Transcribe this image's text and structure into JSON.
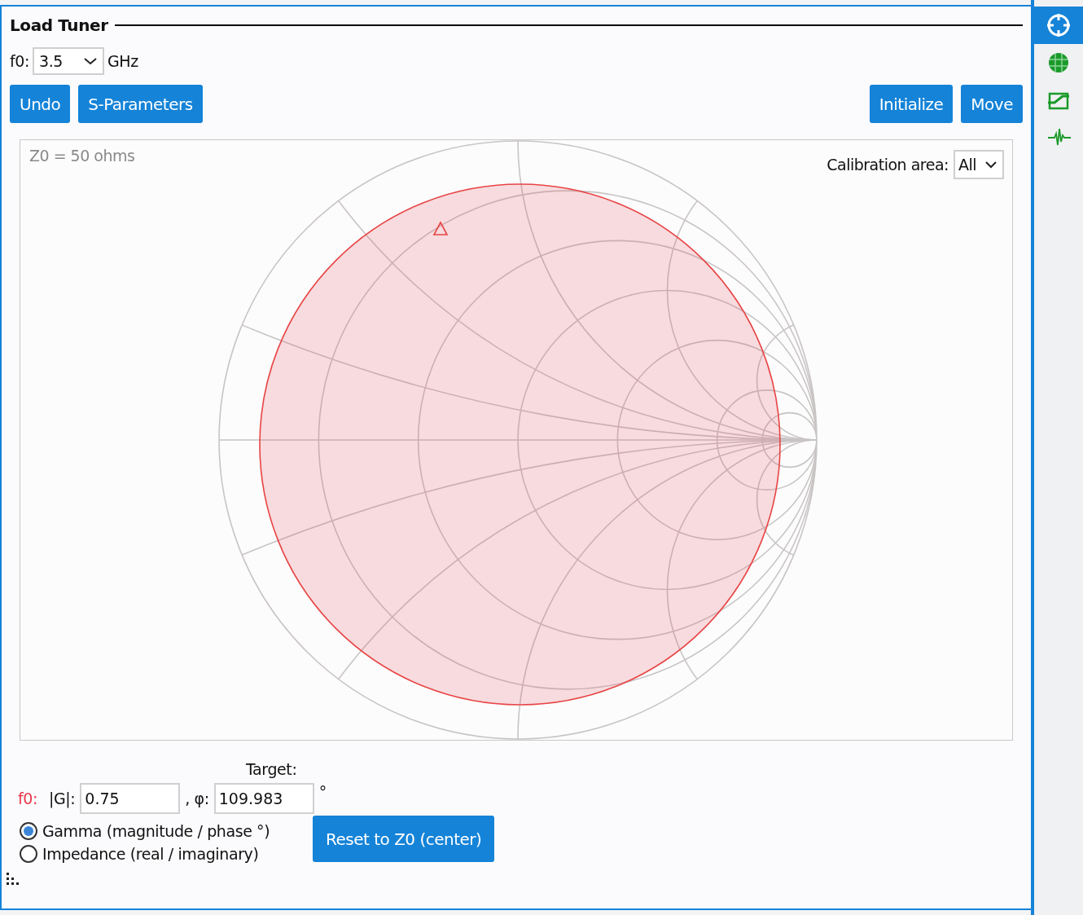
{
  "panel": {
    "title": "Load Tuner"
  },
  "frequency": {
    "label": "f0:",
    "value": "3.5",
    "unit": "GHz"
  },
  "toolbar": {
    "left_buttons": [
      "Undo",
      "S-Parameters"
    ],
    "right_buttons": [
      "Initialize",
      "Move"
    ]
  },
  "chart": {
    "z0_label": "Z0 = 50 ohms",
    "calibration_label": "Calibration area:",
    "calibration_value": "All"
  },
  "target": {
    "heading": "Target:",
    "frequency_label": "f0:",
    "magnitude_label": "|G|:",
    "magnitude_value": "0.75",
    "phase_label": ", φ:",
    "phase_value": "109.983",
    "phase_unit": "°"
  },
  "modes": [
    {
      "label": "Gamma (magnitude / phase °)",
      "selected": true
    },
    {
      "label": "Impedance (real / imaginary)",
      "selected": false
    }
  ],
  "reset_button": "Reset to Z0 (center)",
  "sidebar": [
    {
      "selected": true
    },
    {
      "selected": false
    },
    {
      "selected": false
    },
    {
      "selected": false
    }
  ]
}
